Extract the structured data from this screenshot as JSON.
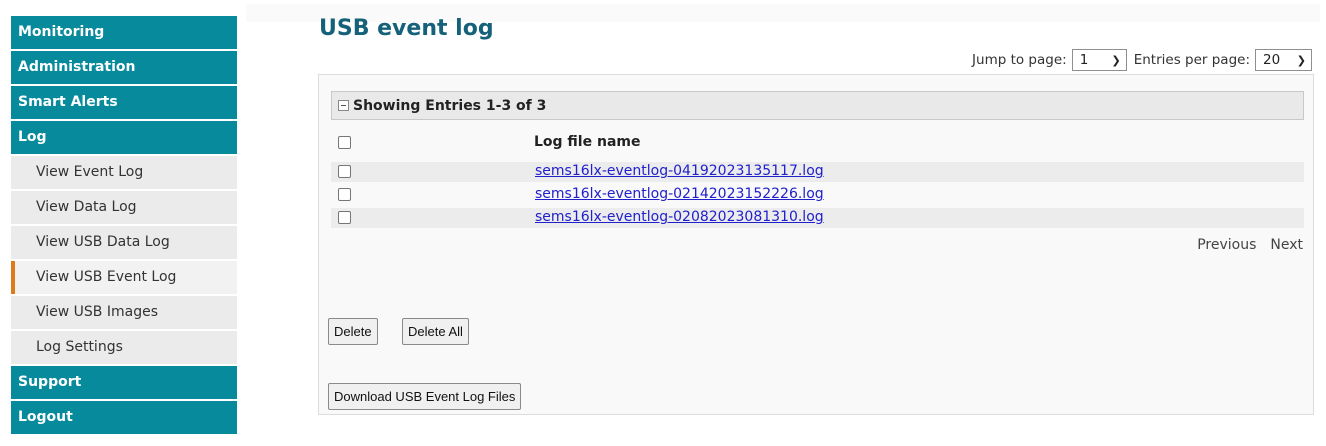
{
  "sidebar": {
    "sections": [
      {
        "label": "Monitoring"
      },
      {
        "label": "Administration"
      },
      {
        "label": "Smart Alerts"
      },
      {
        "label": "Log"
      }
    ],
    "log_items": [
      {
        "label": "View Event Log"
      },
      {
        "label": "View Data Log"
      },
      {
        "label": "View USB Data Log"
      },
      {
        "label": "View USB Event Log",
        "active": true
      },
      {
        "label": "View USB Images"
      },
      {
        "label": "Log Settings"
      }
    ],
    "bottom_sections": [
      {
        "label": "Support"
      },
      {
        "label": "Logout"
      }
    ]
  },
  "page": {
    "title": "USB event log"
  },
  "pager_top": {
    "jump_label": "Jump to page:",
    "page_value": "1",
    "entries_label": "Entries per page:",
    "entries_value": "20"
  },
  "panel": {
    "showing_label": "Showing Entries 1-3 of 3",
    "column_header": "Log file name",
    "files": [
      {
        "name": "sems16lx-eventlog-04192023135117.log"
      },
      {
        "name": "sems16lx-eventlog-02142023152226.log"
      },
      {
        "name": "sems16lx-eventlog-02082023081310.log"
      }
    ],
    "pager": {
      "previous": "Previous",
      "next": "Next"
    },
    "buttons": {
      "delete": "Delete",
      "delete_all": "Delete All",
      "download": "Download USB Event Log Files"
    }
  },
  "colors": {
    "nav_header": "#078a9c",
    "nav_sub": "#ebebeb",
    "active_marker": "#e07b1a",
    "title": "#16617a",
    "link": "#2020cc"
  }
}
